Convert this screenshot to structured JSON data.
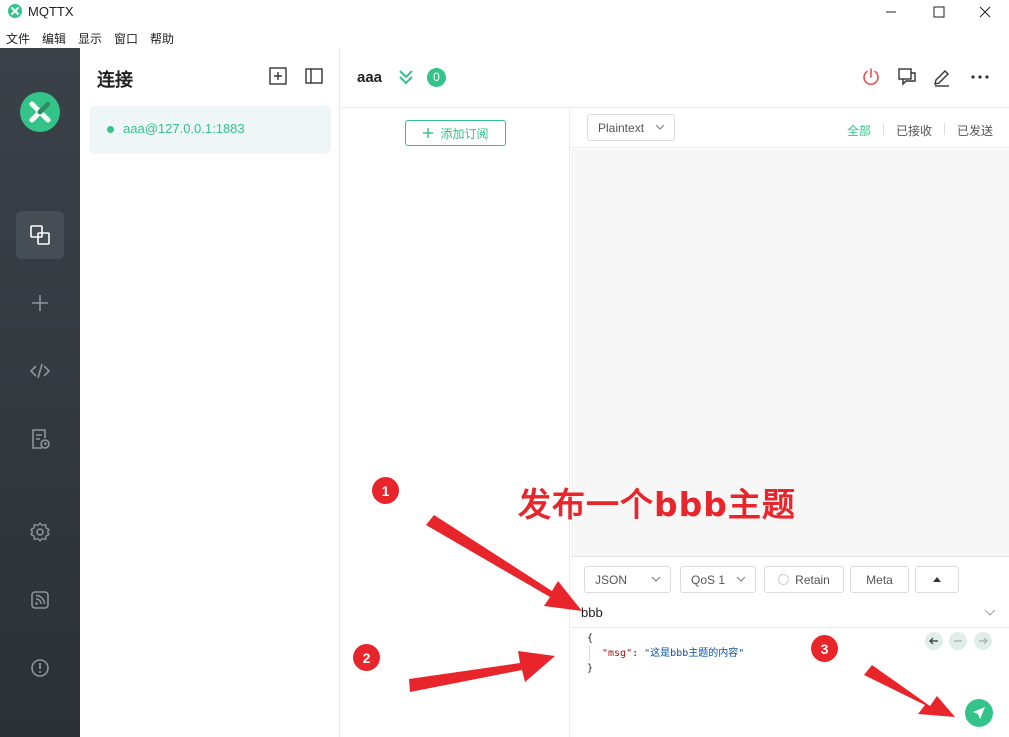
{
  "window": {
    "title": "MQTTX"
  },
  "menu": [
    "文件",
    "编辑",
    "显示",
    "窗口",
    "帮助"
  ],
  "connections": {
    "title": "连接",
    "items": [
      {
        "label": "aaa@127.0.0.1:1883",
        "status_color": "#34c388"
      }
    ]
  },
  "header": {
    "name": "aaa",
    "message_count": "0"
  },
  "subscriptions": {
    "add_label": "添加订阅"
  },
  "messages": {
    "format": "Plaintext",
    "filters": [
      "全部",
      "已接收",
      "已发送"
    ],
    "active_filter": "全部"
  },
  "publish": {
    "payload_format": "JSON",
    "qos": "QoS 1",
    "retain_label": "Retain",
    "meta_label": "Meta",
    "topic": "bbb",
    "payload_open": "{",
    "payload_key": "\"msg\"",
    "payload_colon": ": ",
    "payload_value": "\"这是bbb主题的内容\"",
    "payload_close": "}"
  },
  "annotation": {
    "caption": "发布一个bbb主题",
    "steps": [
      "1",
      "2",
      "3"
    ],
    "color": "#e8252a"
  },
  "theme": {
    "accent": "#34c388",
    "nav_bg": "#2f353b"
  }
}
